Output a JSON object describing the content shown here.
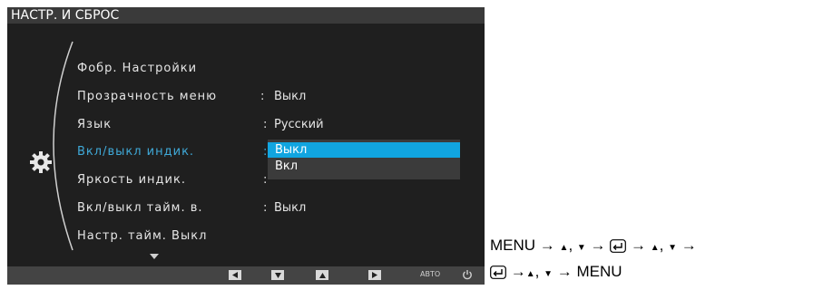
{
  "osd": {
    "title": "НАСТР. И СБРОС",
    "items": [
      {
        "label": "Фобр. Настройки",
        "separator": "",
        "value": ""
      },
      {
        "label": "Прозрачность меню",
        "separator": ":",
        "value": "Выкл"
      },
      {
        "label": "Язык",
        "separator": ":",
        "value": "Русский"
      },
      {
        "label": "Вкл/выкл индик.",
        "separator": ":",
        "value": ""
      },
      {
        "label": "Яркость индик.",
        "separator": ":",
        "value": ""
      },
      {
        "label": "Вкл/выкл тайм. в.",
        "separator": ":",
        "value": "Выкл"
      },
      {
        "label": "Настр. тайм. Выкл",
        "separator": "",
        "value": ""
      }
    ],
    "active_item_index": 3,
    "dropdown": {
      "options": [
        "Выкл",
        "Вкл"
      ],
      "selected_index": 0
    },
    "bottom_bar": {
      "auto_label": "АВТО"
    },
    "colors": {
      "active_text": "#3fa9d8",
      "selected_option_bg": "#11a5e0"
    }
  },
  "instructions": {
    "line1_menu": "MENU",
    "line2_menu": "MENU",
    "arrow": "→",
    "comma": ","
  }
}
